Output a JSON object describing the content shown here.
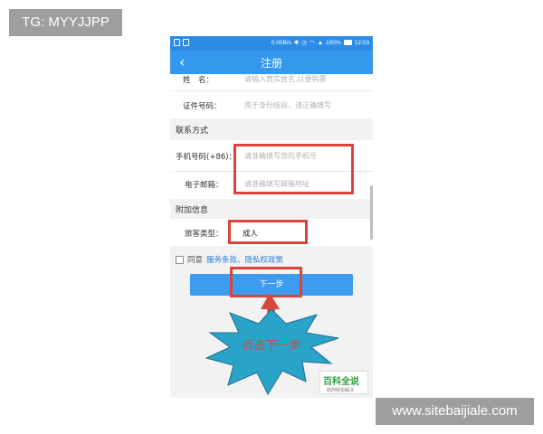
{
  "watermarks": {
    "top_left": "TG: MYYJJPP",
    "bottom_right": "www.sitebaijiale.com"
  },
  "statusbar": {
    "net_speed": "0.00B/s",
    "battery": "100%",
    "time": "12:03"
  },
  "navbar": {
    "back_icon": "chevron-left-icon",
    "title": "注册"
  },
  "form": {
    "name": {
      "label": "姓　名：",
      "placeholder": "请输入真实姓名,以便购票"
    },
    "id_number": {
      "label": "证件号码：",
      "placeholder": "用于身份核验，请正确填写"
    },
    "contact_section": "联系方式",
    "phone": {
      "label": "手机号码(+86)：",
      "placeholder": "请准确填写您的手机号"
    },
    "email": {
      "label": "电子邮箱：",
      "placeholder": "请准确填写邮箱地址"
    },
    "extra_section": "附加信息",
    "passenger_type": {
      "label": "旅客类型：",
      "value": "成人"
    }
  },
  "agreement": {
    "prefix": "同意",
    "link_text": "服务条款、隐私权政策",
    "checked": false
  },
  "next_button": {
    "label": "下一步"
  },
  "annotation": {
    "callout_text": "点击下一步",
    "callout_color": "#2aa3c9",
    "highlight_color": "#d9453a"
  },
  "badge": {
    "title": "百科全说",
    "subtitle": "助你轻松解决"
  }
}
